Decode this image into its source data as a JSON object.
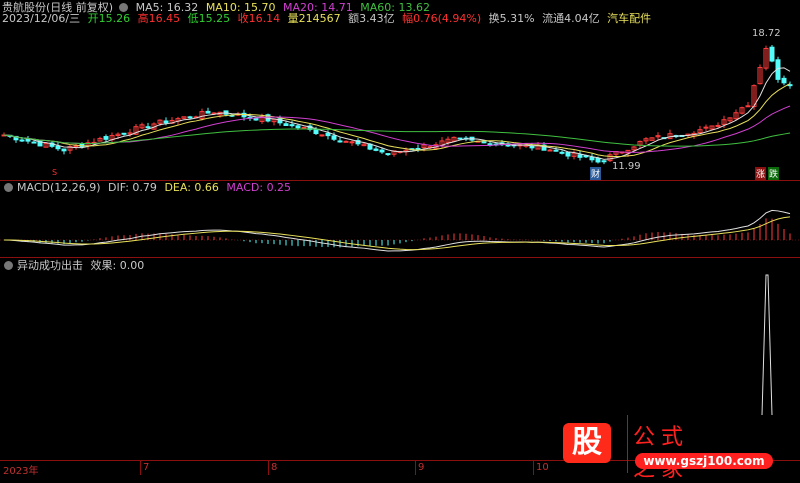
{
  "header": {
    "stock_name": "贵航股份(日线 前复权)",
    "ma5": "MA5: 16.32",
    "ma10": "MA10: 15.70",
    "ma20": "MA20: 14.71",
    "ma60": "MA60: 13.62",
    "date": "2023/12/06/三",
    "open_label": "开",
    "open": "15.26",
    "high_label": "高",
    "high": "16.45",
    "low_label": "低",
    "low": "15.25",
    "close_label": "收",
    "close": "16.14",
    "vol_label": "量",
    "vol": "214567",
    "amount": "额3.43亿",
    "change_label": "幅",
    "change": "0.76(4.94%)",
    "turnover": "换5.31%",
    "float_cap": "流通4.04亿",
    "industry": "汽车配件"
  },
  "price_panel": {
    "high_marker": "18.72",
    "low_marker": "11.99",
    "badge_cai": "财",
    "badge_zhang": "涨",
    "badge_die": "跌",
    "s_marker": "S",
    "keypoints": [
      [
        0,
        13.64
      ],
      [
        10,
        12.9
      ],
      [
        25,
        14.2
      ],
      [
        35,
        14.8
      ],
      [
        44,
        14.4
      ],
      [
        52,
        13.8
      ],
      [
        64,
        12.7
      ],
      [
        75,
        13.4
      ],
      [
        90,
        13.0
      ],
      [
        99,
        12.3
      ],
      [
        107,
        13.4
      ],
      [
        118,
        14.0
      ],
      [
        124,
        15.2
      ],
      [
        127,
        18.0
      ],
      [
        129,
        16.5
      ],
      [
        131,
        16.14
      ]
    ]
  },
  "macd": {
    "title": "MACD(12,26,9)",
    "dif": "DIF: 0.79",
    "dea": "DEA: 0.66",
    "macd": "MACD: 0.25"
  },
  "indicator": {
    "title": "异动成功出击",
    "effect": "效果: 0.00"
  },
  "xaxis": {
    "labels": [
      "2023年",
      "7",
      "8",
      "9",
      "10"
    ]
  },
  "logo": {
    "text": "公式之家",
    "url": "www.gszj100.com",
    "badge": "股"
  },
  "colors": {
    "up": "#ff3c3c",
    "down": "#54fcfc",
    "ma5": "#e0e0e0",
    "ma10": "#e8e05a",
    "ma20": "#d040d0",
    "ma60": "#40c040"
  }
}
